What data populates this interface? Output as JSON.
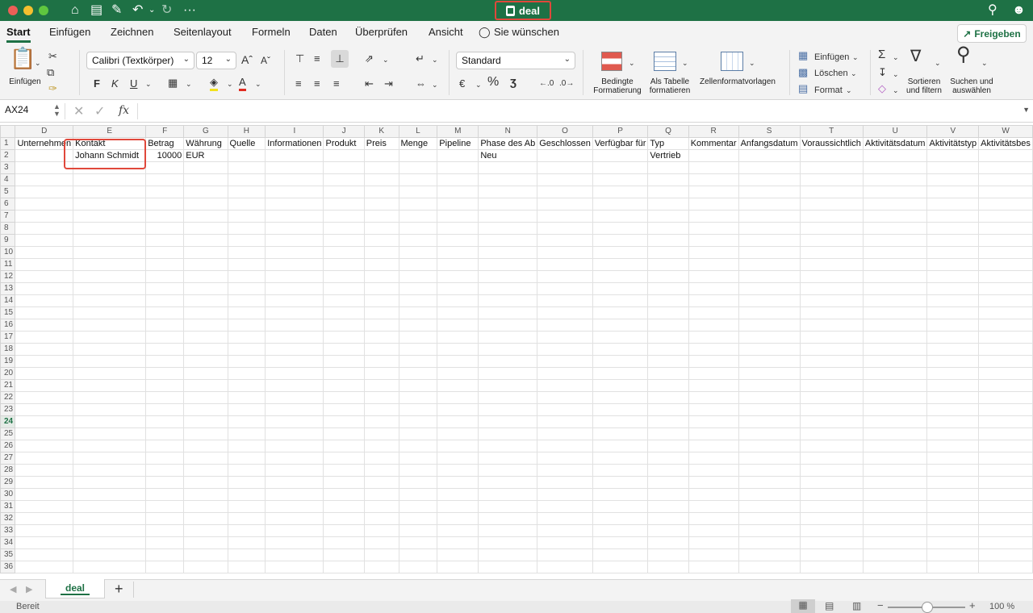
{
  "window": {
    "title": "deal",
    "traffic_lights": [
      "#ec5f57",
      "#f5bf2f",
      "#5fc63f"
    ]
  },
  "quick_access": {
    "icons": [
      "home-icon",
      "save-icon",
      "save-edit-icon",
      "undo-icon",
      "redo-icon",
      "more-icon"
    ],
    "more_label": "···"
  },
  "tabs": [
    "Start",
    "Einfügen",
    "Zeichnen",
    "Seitenlayout",
    "Formeln",
    "Daten",
    "Überprüfen",
    "Ansicht"
  ],
  "tell_me": "Sie wünschen",
  "share_label": "Freigeben",
  "ribbon": {
    "paste_label": "Einfügen",
    "font_name": "Calibri (Textkörper)",
    "font_size": "12",
    "grow_font": "Aˆ",
    "shrink_font": "Aˇ",
    "bold": "F",
    "italic": "K",
    "underline": "U",
    "font_color": "A",
    "number_format": "Standard",
    "percent": "%",
    "comma": "ʒ",
    "cond_format_1": "Bedingte",
    "cond_format_2": "Formatierung",
    "as_table_1": "Als Tabelle",
    "as_table_2": "formatieren",
    "cell_styles": "Zellenformatvorlagen",
    "insert_cells": "Einfügen",
    "delete_cells": "Löschen",
    "format_cells": "Format",
    "sort_1": "Sortieren",
    "sort_2": "und filtern",
    "find_1": "Suchen und",
    "find_2": "auswählen",
    "accent": "#1e7145"
  },
  "formula_bar": {
    "name_box": "AX24",
    "fx": "fx",
    "value": ""
  },
  "sheet": {
    "columns": [
      "D",
      "E",
      "F",
      "G",
      "H",
      "I",
      "J",
      "K",
      "L",
      "M",
      "N",
      "O",
      "P",
      "Q",
      "R",
      "S",
      "T",
      "U",
      "V",
      "W"
    ],
    "row_count": 36,
    "selected_row": 24,
    "rows": [
      [
        "Unternehmen",
        "Kontakt",
        "Betrag",
        "Währung",
        "Quelle",
        "Informationen",
        "Produkt",
        "Preis",
        "Menge",
        "Pipeline",
        "Phase des Ab",
        "Geschlossen",
        "Verfügbar für",
        "Typ",
        "Kommentar",
        "Anfangsdatum",
        "Voraussichtlich",
        "Aktivitätsdatum",
        "Aktivitätstyp",
        "Aktivitätsbes"
      ],
      [
        "",
        "Johann Schmidt",
        "10000",
        "EUR",
        "",
        "",
        "",
        "",
        "",
        "",
        "Neu",
        "",
        "",
        "Vertrieb",
        "",
        "",
        "",
        "",
        "",
        ""
      ]
    ]
  },
  "sheet_tabs": [
    "deal"
  ],
  "add_sheet": "+",
  "status": {
    "text": "Bereit",
    "zoom": "100 %"
  }
}
